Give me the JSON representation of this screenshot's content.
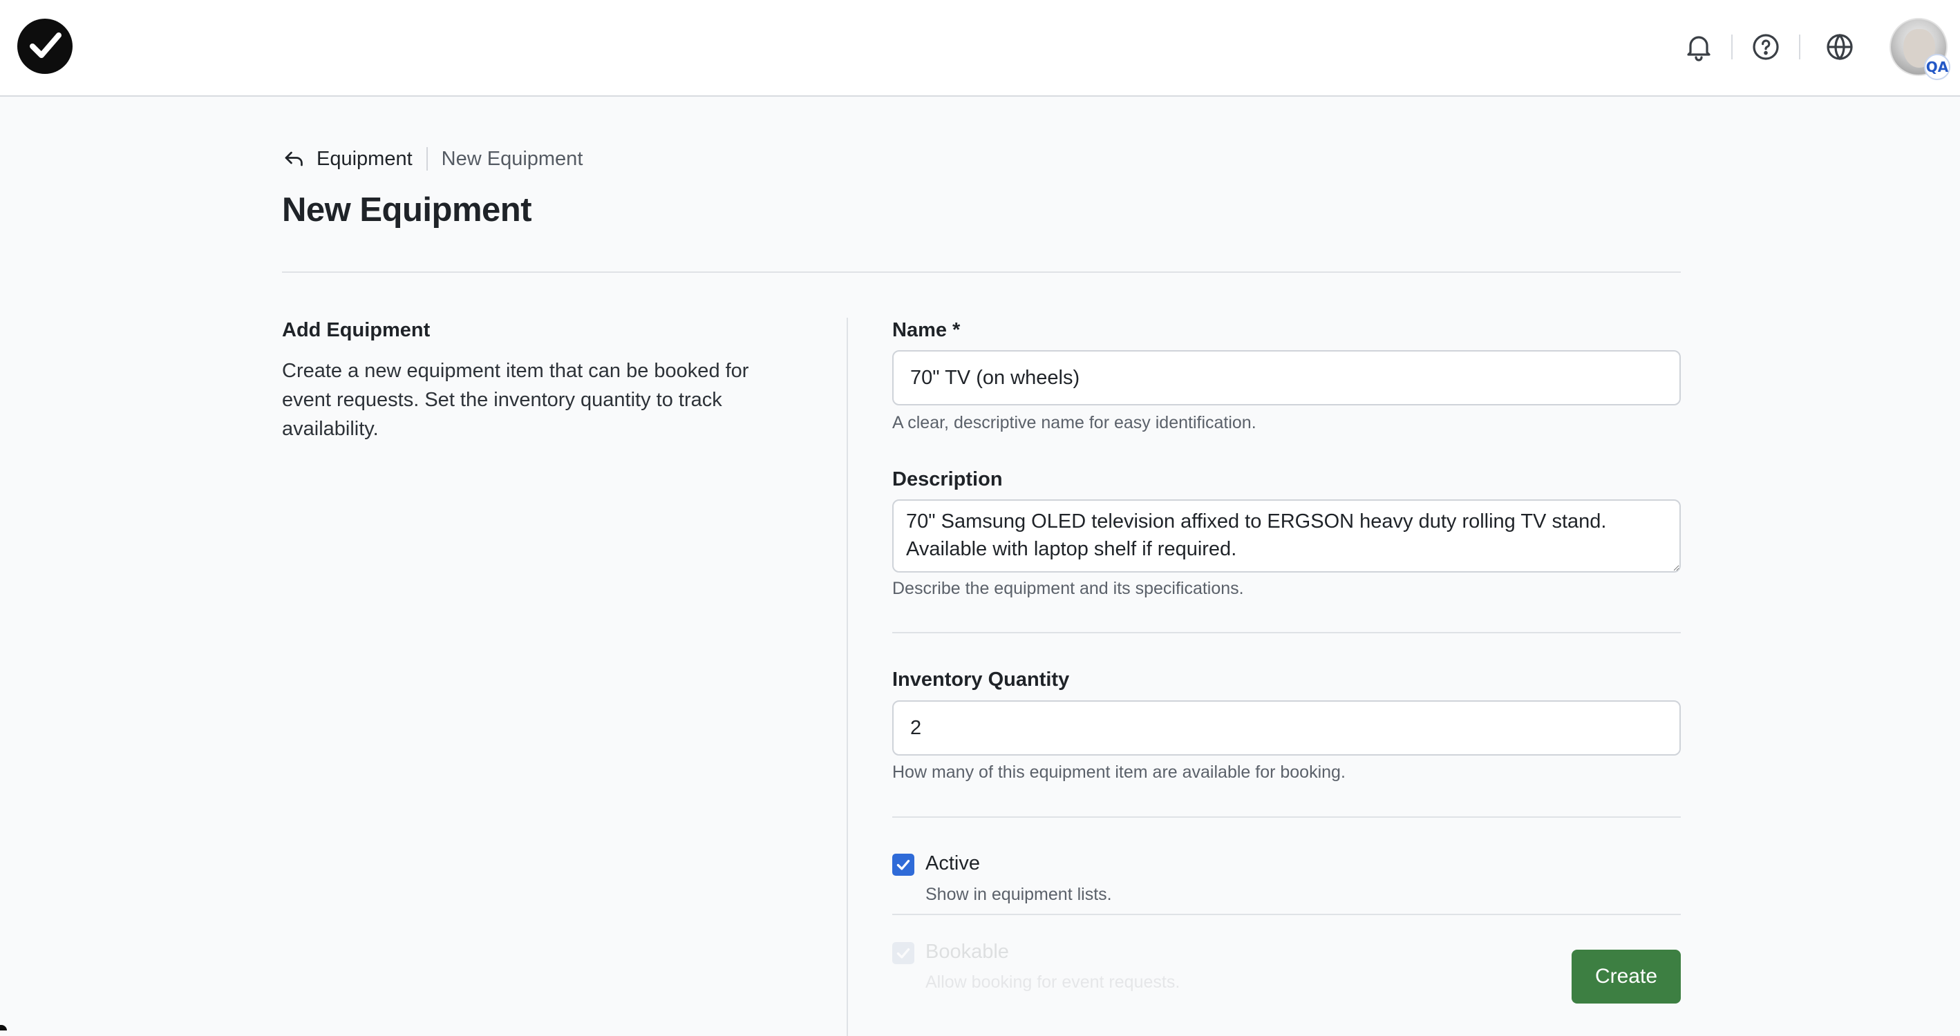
{
  "header": {
    "logo_icon": "check-circle-logo",
    "icons": [
      "bell-icon",
      "help-circle-icon",
      "globe-icon"
    ],
    "avatar_badge": "QA"
  },
  "breadcrumb": {
    "back_icon": "reply-arrow-icon",
    "parent": "Equipment",
    "current": "New Equipment"
  },
  "page": {
    "title": "New Equipment"
  },
  "section": {
    "heading": "Add Equipment",
    "description": "Create a new equipment item that can be booked for event requests. Set the inventory quantity to track availability."
  },
  "form": {
    "name": {
      "label": "Name *",
      "value": "70\" TV (on wheels)",
      "helper": "A clear, descriptive name for easy identification."
    },
    "description": {
      "label": "Description",
      "value": "70\" Samsung OLED television affixed to ERGSON heavy duty rolling TV stand. Available with laptop shelf if required.",
      "helper": "Describe the equipment and its specifications."
    },
    "inventory": {
      "label": "Inventory Quantity",
      "value": "2",
      "helper": "How many of this equipment item are available for booking."
    },
    "active": {
      "label": "Active",
      "helper": "Show in equipment lists.",
      "checked": true
    },
    "bookable": {
      "label": "Bookable",
      "helper": "Allow booking for event requests.",
      "checked": true
    },
    "submit_label": "Create"
  },
  "colors": {
    "primary_button": "#3d7f42",
    "checkbox": "#2f6bd8"
  }
}
